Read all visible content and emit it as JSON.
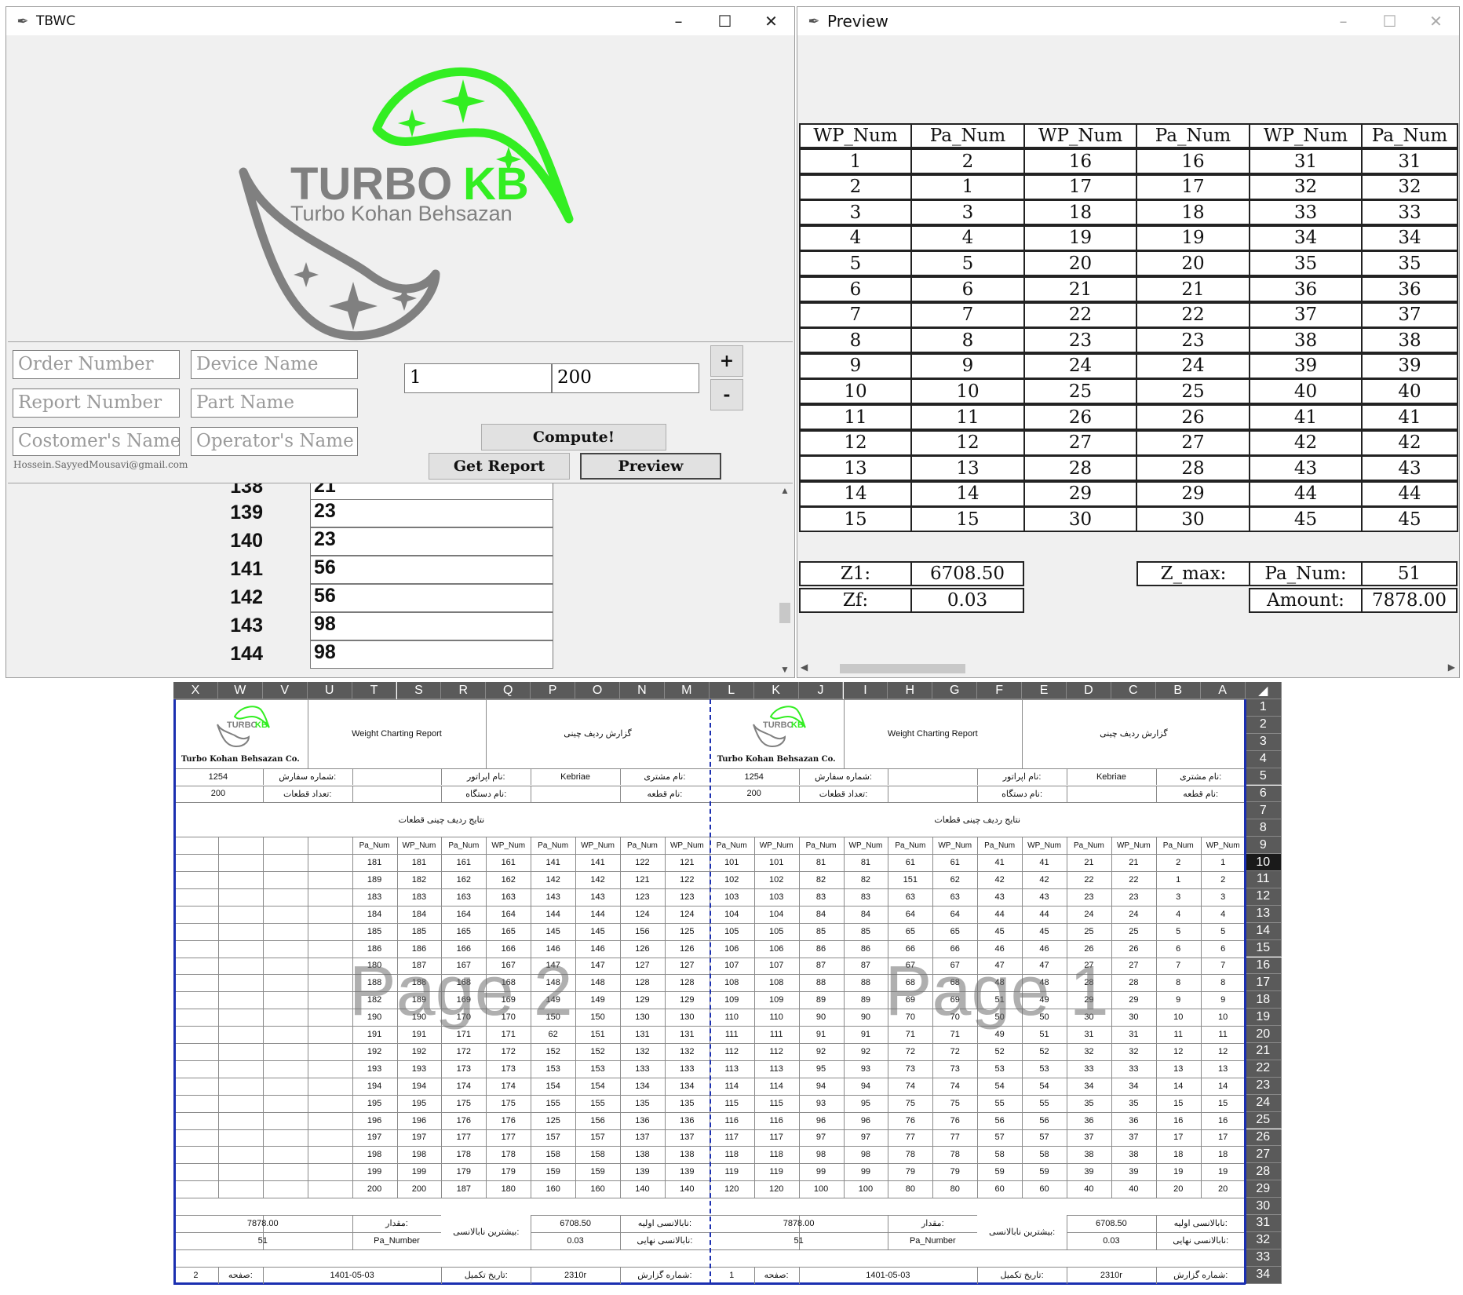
{
  "app": {
    "title": "TBWC",
    "logo": {
      "brand_gray": "TURBO",
      "brand_green": "KB",
      "tagline": "Turbo Kohan Behsazan",
      "green": "#33ee22",
      "gray": "#808080"
    },
    "fields": {
      "order_number": "Order Number",
      "device_name": "Device Name",
      "report_number": "Report Number",
      "part_name": "Part Name",
      "customer_name": "Costomer's Name",
      "operator_name": "Operator's Name"
    },
    "email": "Hossein.SayyedMousavi@gmail.com",
    "range_from": "1",
    "range_to": "200",
    "plus": "+",
    "minus": "-",
    "compute": "Compute!",
    "get_report": "Get Report",
    "preview": "Preview",
    "list": [
      {
        "n": "138",
        "v": "21"
      },
      {
        "n": "139",
        "v": "23"
      },
      {
        "n": "140",
        "v": "23"
      },
      {
        "n": "141",
        "v": "56"
      },
      {
        "n": "142",
        "v": "56"
      },
      {
        "n": "143",
        "v": "98"
      },
      {
        "n": "144",
        "v": "98"
      }
    ]
  },
  "preview": {
    "title": "Preview",
    "headers": [
      "WP_Num",
      "Pa_Num",
      "WP_Num",
      "Pa_Num",
      "WP_Num",
      "Pa_Num"
    ],
    "rows": [
      [
        "1",
        "2",
        "16",
        "16",
        "31",
        "31"
      ],
      [
        "2",
        "1",
        "17",
        "17",
        "32",
        "32"
      ],
      [
        "3",
        "3",
        "18",
        "18",
        "33",
        "33"
      ],
      [
        "4",
        "4",
        "19",
        "19",
        "34",
        "34"
      ],
      [
        "5",
        "5",
        "20",
        "20",
        "35",
        "35"
      ],
      [
        "6",
        "6",
        "21",
        "21",
        "36",
        "36"
      ],
      [
        "7",
        "7",
        "22",
        "22",
        "37",
        "37"
      ],
      [
        "8",
        "8",
        "23",
        "23",
        "38",
        "38"
      ],
      [
        "9",
        "9",
        "24",
        "24",
        "39",
        "39"
      ],
      [
        "10",
        "10",
        "25",
        "25",
        "40",
        "40"
      ],
      [
        "11",
        "11",
        "26",
        "26",
        "41",
        "41"
      ],
      [
        "12",
        "12",
        "27",
        "27",
        "42",
        "42"
      ],
      [
        "13",
        "13",
        "28",
        "28",
        "43",
        "43"
      ],
      [
        "14",
        "14",
        "29",
        "29",
        "44",
        "44"
      ],
      [
        "15",
        "15",
        "30",
        "30",
        "45",
        "45"
      ]
    ],
    "z1_label": "Z1:",
    "z1": "6708.50",
    "zf_label": "Zf:",
    "zf": "0.03",
    "zmax_label": "Z_max:",
    "pa_num_label": "Pa_Num:",
    "pa_num": "51",
    "amount_label": "Amount:",
    "amount": "7878.00"
  },
  "sheet": {
    "columns": [
      "X",
      "W",
      "V",
      "U",
      "T",
      "S",
      "R",
      "Q",
      "P",
      "O",
      "N",
      "M",
      "L",
      "K",
      "J",
      "I",
      "H",
      "G",
      "F",
      "E",
      "D",
      "C",
      "B",
      "A"
    ],
    "rows": [
      "1",
      "2",
      "3",
      "4",
      "5",
      "6",
      "7",
      "8",
      "9",
      "10",
      "11",
      "12",
      "13",
      "14",
      "15",
      "16",
      "17",
      "18",
      "19",
      "20",
      "21",
      "22",
      "23",
      "24",
      "25",
      "26",
      "27",
      "28",
      "29",
      "30",
      "31",
      "32",
      "33",
      "34"
    ],
    "selected_row": "10",
    "company": "Turbo Kohan Behsazan Co.",
    "report_title": "Weight Charting Report",
    "report_title_fa": "گزارش ردیف چینی",
    "customer_label": "نام مشتری:",
    "customer": "Kebriae",
    "operator_label": "نام اپراتور:",
    "order_label": "شماره سفارش:",
    "order": "1254",
    "part_label": "نام قطعه:",
    "device_label": "نام دستگاه:",
    "count_label": "تعداد قطعات:",
    "count": "200",
    "results_title": "نتایج ردیف چینی قطعات",
    "hdr_wp": "WP_Num",
    "hdr_pa": "Pa_Num",
    "z1_label": "نابالانسی اولیه:",
    "z1": "6708.50",
    "zf_label": "نابالانسی نهایی:",
    "zf": "0.03",
    "zmax_label": "بیشترین نابالانسی:",
    "amount_label": "مقدار:",
    "amount": "7878.00",
    "pa_number": "Pa_Number",
    "pa_number_val": "51",
    "report_no_label": "شماره گزارش:",
    "report_no": "2310r",
    "date_label": "تاریخ تکمیل:",
    "date": "1401-05-03",
    "page_label": "صفحه:",
    "pages": [
      {
        "watermark": "Page 1",
        "page_no": "1",
        "rows": [
          [
            "1",
            "2",
            "21",
            "21",
            "41",
            "41",
            "61",
            "61",
            "81",
            "81",
            "101",
            "101"
          ],
          [
            "2",
            "1",
            "22",
            "22",
            "42",
            "42",
            "62",
            "151",
            "82",
            "82",
            "102",
            "102"
          ],
          [
            "3",
            "3",
            "23",
            "23",
            "43",
            "43",
            "63",
            "63",
            "83",
            "83",
            "103",
            "103"
          ],
          [
            "4",
            "4",
            "24",
            "24",
            "44",
            "44",
            "64",
            "64",
            "84",
            "84",
            "104",
            "104"
          ],
          [
            "5",
            "5",
            "25",
            "25",
            "45",
            "45",
            "65",
            "65",
            "85",
            "85",
            "105",
            "105"
          ],
          [
            "6",
            "6",
            "26",
            "26",
            "46",
            "46",
            "66",
            "66",
            "86",
            "86",
            "106",
            "106"
          ],
          [
            "7",
            "7",
            "27",
            "27",
            "47",
            "47",
            "67",
            "67",
            "87",
            "87",
            "107",
            "107"
          ],
          [
            "8",
            "8",
            "28",
            "28",
            "48",
            "48",
            "68",
            "68",
            "88",
            "88",
            "108",
            "108"
          ],
          [
            "9",
            "9",
            "29",
            "29",
            "49",
            "51",
            "69",
            "69",
            "89",
            "89",
            "109",
            "109"
          ],
          [
            "10",
            "10",
            "30",
            "30",
            "50",
            "50",
            "70",
            "70",
            "90",
            "90",
            "110",
            "110"
          ],
          [
            "11",
            "11",
            "31",
            "31",
            "51",
            "49",
            "71",
            "71",
            "91",
            "91",
            "111",
            "111"
          ],
          [
            "12",
            "12",
            "32",
            "32",
            "52",
            "52",
            "72",
            "72",
            "92",
            "92",
            "112",
            "112"
          ],
          [
            "13",
            "13",
            "33",
            "33",
            "53",
            "53",
            "73",
            "73",
            "93",
            "95",
            "113",
            "113"
          ],
          [
            "14",
            "14",
            "34",
            "34",
            "54",
            "54",
            "74",
            "74",
            "94",
            "94",
            "114",
            "114"
          ],
          [
            "15",
            "15",
            "35",
            "35",
            "55",
            "55",
            "75",
            "75",
            "95",
            "93",
            "115",
            "115"
          ],
          [
            "16",
            "16",
            "36",
            "36",
            "56",
            "56",
            "76",
            "76",
            "96",
            "96",
            "116",
            "116"
          ],
          [
            "17",
            "17",
            "37",
            "37",
            "57",
            "57",
            "77",
            "77",
            "97",
            "97",
            "117",
            "117"
          ],
          [
            "18",
            "18",
            "38",
            "38",
            "58",
            "58",
            "78",
            "78",
            "98",
            "98",
            "118",
            "118"
          ],
          [
            "19",
            "19",
            "39",
            "39",
            "59",
            "59",
            "79",
            "79",
            "99",
            "99",
            "119",
            "119"
          ],
          [
            "20",
            "20",
            "40",
            "40",
            "60",
            "60",
            "80",
            "80",
            "100",
            "100",
            "120",
            "120"
          ]
        ]
      },
      {
        "watermark": "Page 2",
        "page_no": "2",
        "rows": [
          [
            "121",
            "122",
            "141",
            "141",
            "161",
            "161",
            "181",
            "181",
            "",
            "",
            "",
            ""
          ],
          [
            "122",
            "121",
            "142",
            "142",
            "162",
            "162",
            "182",
            "189",
            "",
            "",
            "",
            ""
          ],
          [
            "123",
            "123",
            "143",
            "143",
            "163",
            "163",
            "183",
            "183",
            "",
            "",
            "",
            ""
          ],
          [
            "124",
            "124",
            "144",
            "144",
            "164",
            "164",
            "184",
            "184",
            "",
            "",
            "",
            ""
          ],
          [
            "125",
            "156",
            "145",
            "145",
            "165",
            "165",
            "185",
            "185",
            "",
            "",
            "",
            ""
          ],
          [
            "126",
            "126",
            "146",
            "146",
            "166",
            "166",
            "186",
            "186",
            "",
            "",
            "",
            ""
          ],
          [
            "127",
            "127",
            "147",
            "147",
            "167",
            "167",
            "187",
            "180",
            "",
            "",
            "",
            ""
          ],
          [
            "128",
            "128",
            "148",
            "148",
            "168",
            "168",
            "188",
            "188",
            "",
            "",
            "",
            ""
          ],
          [
            "129",
            "129",
            "149",
            "149",
            "169",
            "169",
            "189",
            "182",
            "",
            "",
            "",
            ""
          ],
          [
            "130",
            "130",
            "150",
            "150",
            "170",
            "170",
            "190",
            "190",
            "",
            "",
            "",
            ""
          ],
          [
            "131",
            "131",
            "151",
            "62",
            "171",
            "171",
            "191",
            "191",
            "",
            "",
            "",
            ""
          ],
          [
            "132",
            "132",
            "152",
            "152",
            "172",
            "172",
            "192",
            "192",
            "",
            "",
            "",
            ""
          ],
          [
            "133",
            "133",
            "153",
            "153",
            "173",
            "173",
            "193",
            "193",
            "",
            "",
            "",
            ""
          ],
          [
            "134",
            "134",
            "154",
            "154",
            "174",
            "174",
            "194",
            "194",
            "",
            "",
            "",
            ""
          ],
          [
            "135",
            "135",
            "155",
            "155",
            "175",
            "175",
            "195",
            "195",
            "",
            "",
            "",
            ""
          ],
          [
            "136",
            "136",
            "156",
            "125",
            "176",
            "176",
            "196",
            "196",
            "",
            "",
            "",
            ""
          ],
          [
            "137",
            "137",
            "157",
            "157",
            "177",
            "177",
            "197",
            "197",
            "",
            "",
            "",
            ""
          ],
          [
            "138",
            "138",
            "158",
            "158",
            "178",
            "178",
            "198",
            "198",
            "",
            "",
            "",
            ""
          ],
          [
            "139",
            "139",
            "159",
            "159",
            "179",
            "179",
            "199",
            "199",
            "",
            "",
            "",
            ""
          ],
          [
            "140",
            "140",
            "160",
            "160",
            "180",
            "187",
            "200",
            "200",
            "",
            "",
            "",
            ""
          ]
        ]
      }
    ]
  }
}
